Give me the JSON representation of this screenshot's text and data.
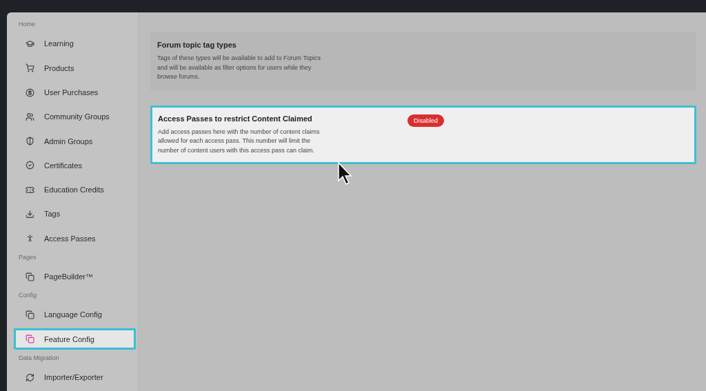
{
  "sidebar": {
    "sections": [
      {
        "title": "Home",
        "items": [
          {
            "label": "Learning",
            "selected": false
          },
          {
            "label": "Products",
            "selected": false
          },
          {
            "label": "User Purchases",
            "selected": false
          },
          {
            "label": "Community Groups",
            "selected": false
          },
          {
            "label": "Admin Groups",
            "selected": false
          },
          {
            "label": "Certificates",
            "selected": false
          },
          {
            "label": "Education Credits",
            "selected": false
          },
          {
            "label": "Tags",
            "selected": false
          },
          {
            "label": "Access Passes",
            "selected": false
          }
        ]
      },
      {
        "title": "Pages",
        "items": [
          {
            "label": "PageBuilder™",
            "selected": false
          }
        ]
      },
      {
        "title": "Config",
        "items": [
          {
            "label": "Language Config",
            "selected": false
          },
          {
            "label": "Feature Config",
            "selected": true
          }
        ]
      },
      {
        "title": "Data Migration",
        "items": [
          {
            "label": "Importer/Exporter",
            "selected": false
          }
        ]
      }
    ]
  },
  "features": [
    {
      "title": "Forum topic tag types",
      "description": "Tags of these types will be available to add to Forum Topics and will be available as filter options for users while they browse forums.",
      "highlighted": false
    },
    {
      "title": "Access Passes to restrict Content Claimed",
      "description": "Add access passes here with the number of content claims allowed for each access pass. This number will limit the number of content users with this access pass can claim.",
      "highlighted": true,
      "status": "Disabled"
    }
  ]
}
